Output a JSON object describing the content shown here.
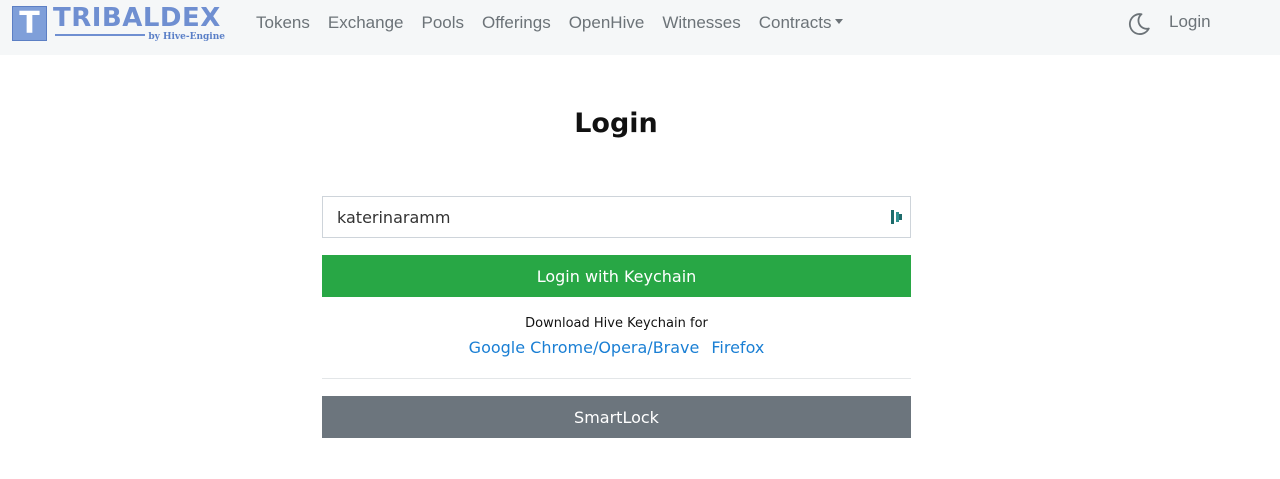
{
  "brand": {
    "mark_letter": "T",
    "name": "TRIBALDEX",
    "subtitle": "by Hive-Engine",
    "color": "#6f8fd1"
  },
  "nav": {
    "items": [
      {
        "label": "Tokens"
      },
      {
        "label": "Exchange"
      },
      {
        "label": "Pools"
      },
      {
        "label": "Offerings"
      },
      {
        "label": "OpenHive"
      },
      {
        "label": "Witnesses"
      },
      {
        "label": "Contracts"
      }
    ],
    "theme_icon": "moon-icon",
    "login_label": "Login"
  },
  "page": {
    "title": "Login"
  },
  "form": {
    "username_value": "katerinaramm",
    "keychain_icon": "keychain-icon",
    "keychain_button": "Login with Keychain",
    "download_label": "Download Hive Keychain for",
    "links": {
      "chrome": "Google Chrome/Opera/Brave",
      "firefox": "Firefox"
    },
    "smartlock_button": "SmartLock"
  },
  "colors": {
    "primary_green": "#28a745",
    "secondary_gray": "#6c757d",
    "link_blue": "#1a7fd4",
    "navbar_bg": "#f5f7f8"
  }
}
